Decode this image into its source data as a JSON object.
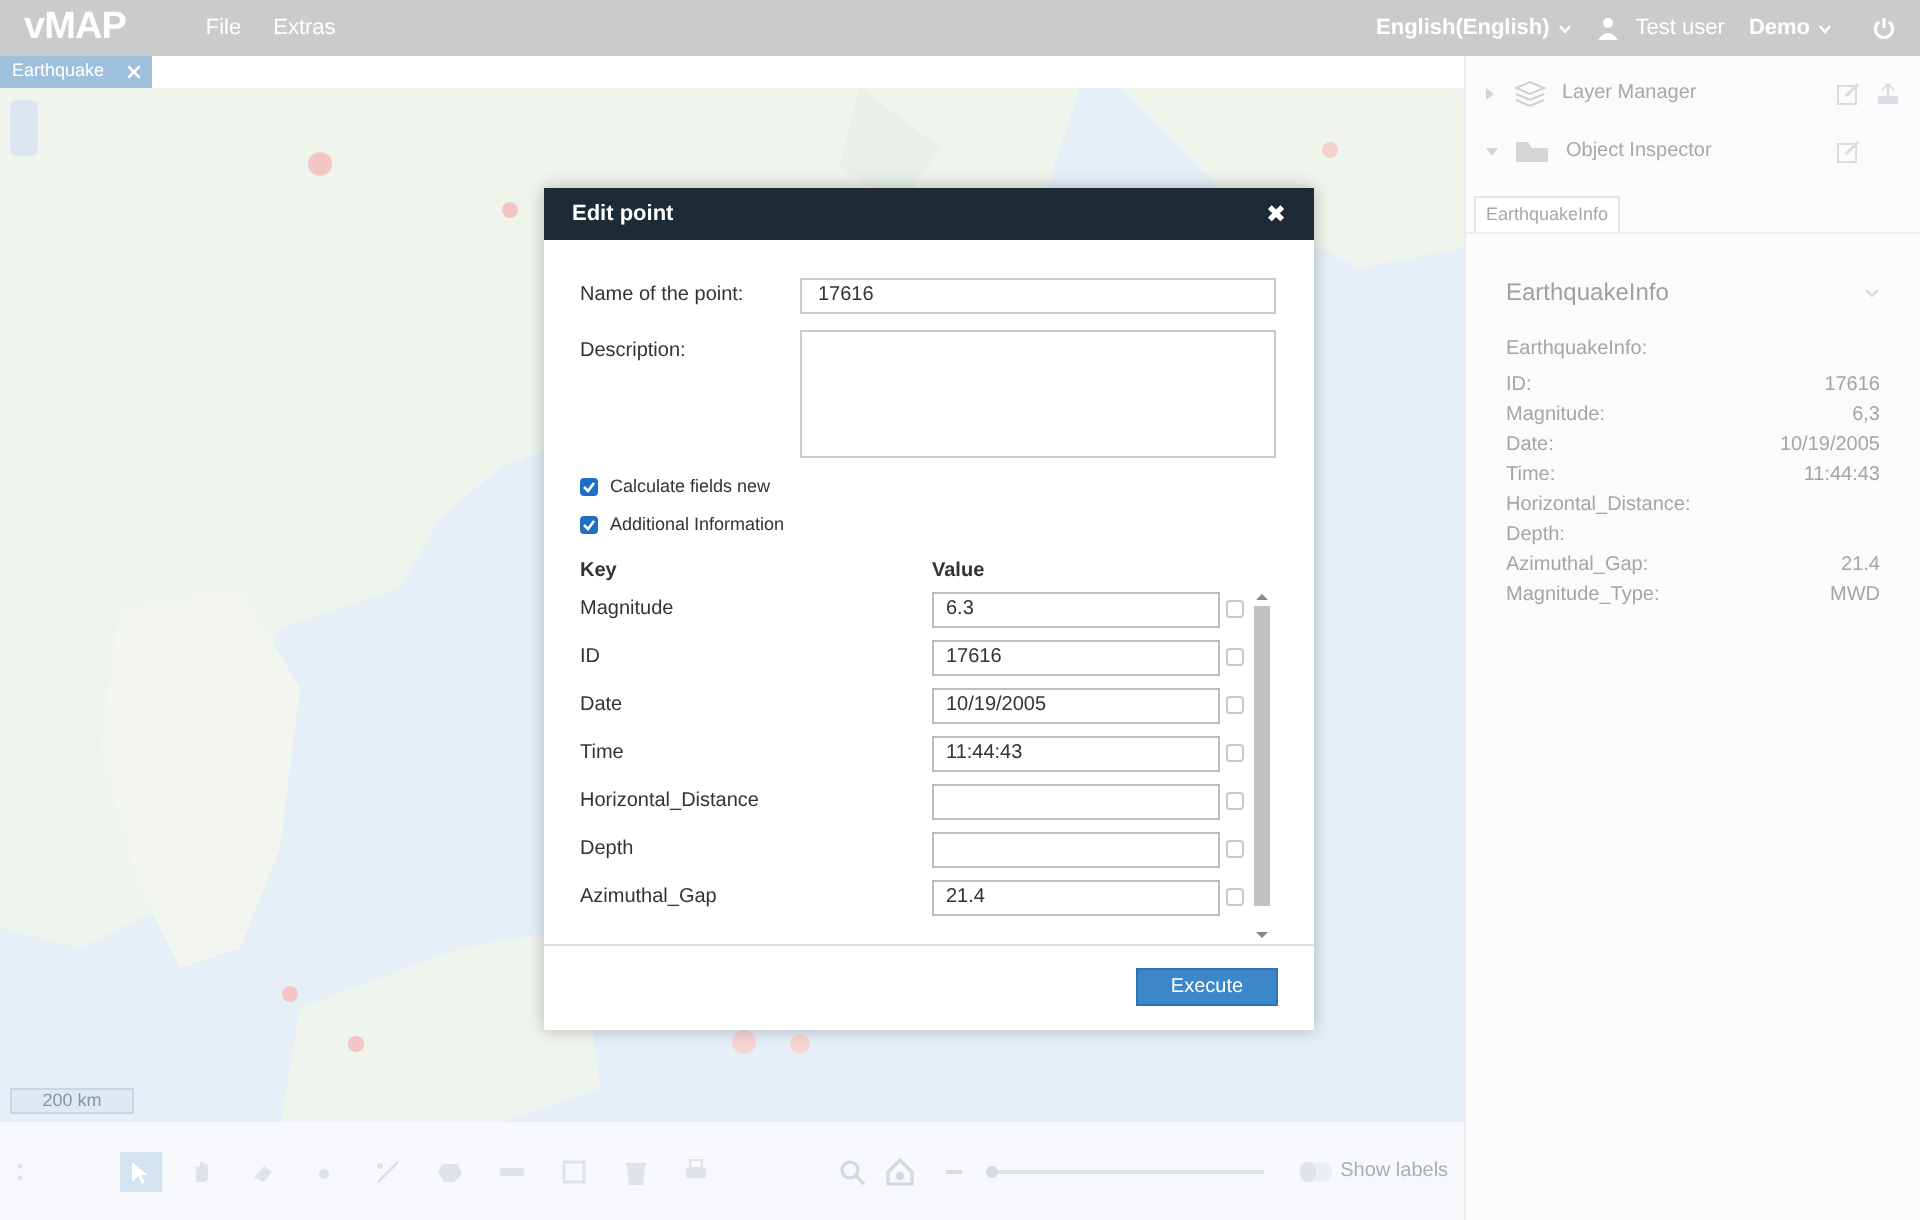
{
  "app": {
    "logo": "vMAP",
    "menu": [
      "File",
      "Extras"
    ],
    "language": "English(English)",
    "user": "Test user",
    "project": "Demo"
  },
  "map_tabs": [
    {
      "label": "Earthquake",
      "selected": true
    }
  ],
  "map": {
    "scale": "200 km"
  },
  "panels": [
    {
      "title": "Layer Manager",
      "expanded": false
    },
    {
      "title": "Object Inspector",
      "expanded": true
    }
  ],
  "inspector_tabs": [
    {
      "label": "EarthquakeInfo",
      "selected": true
    }
  ],
  "info_card": {
    "title": "EarthquakeInfo",
    "subtitle": "EarthquakeInfo:",
    "rows": [
      {
        "key": "ID:",
        "value": "17616"
      },
      {
        "key": "Magnitude:",
        "value": "6,3"
      },
      {
        "key": "Date:",
        "value": "10/19/2005"
      },
      {
        "key": "Time:",
        "value": "11:44:43"
      },
      {
        "key": "Horizontal_Distance:",
        "value": ""
      },
      {
        "key": "Depth:",
        "value": ""
      },
      {
        "key": "Azimuthal_Gap:",
        "value": "21.4"
      },
      {
        "key": "Magnitude_Type:",
        "value": "MWD"
      }
    ]
  },
  "tools": [
    {
      "kind": "select",
      "selected": true
    },
    {
      "kind": "pan",
      "selected": false
    },
    {
      "kind": "eraser",
      "selected": false
    },
    {
      "kind": "point",
      "selected": false
    },
    {
      "kind": "line",
      "selected": false
    },
    {
      "kind": "polygon",
      "selected": false
    },
    {
      "kind": "bar",
      "selected": false
    },
    {
      "kind": "square",
      "selected": false
    },
    {
      "kind": "trash",
      "selected": false
    },
    {
      "kind": "print",
      "selected": false
    }
  ],
  "zoom": {
    "level": 0.0
  },
  "show_labels": {
    "label": "Show labels",
    "on": false
  },
  "dialog": {
    "title": "Edit point",
    "close": "✖",
    "name_label": "Name of the point:",
    "name_value": "17616",
    "description_label": "Description:",
    "checkboxes": [
      {
        "label": "Calculate fields new",
        "checked": true
      },
      {
        "label": "Additional Information",
        "checked": true
      }
    ],
    "columns": [
      "Key",
      "Value"
    ],
    "rows": [
      {
        "key": "Magnitude",
        "value": "6.3",
        "checked": false
      },
      {
        "key": "ID",
        "value": "17616",
        "checked": false
      },
      {
        "key": "Date",
        "value": "10/19/2005",
        "checked": false
      },
      {
        "key": "Time",
        "value": "11:44:43",
        "checked": false
      },
      {
        "key": "Horizontal_Distance",
        "value": "",
        "checked": false
      },
      {
        "key": "Depth",
        "value": "",
        "checked": false
      },
      {
        "key": "Azimuthal_Gap",
        "value": "21.4",
        "checked": false
      }
    ],
    "button": "Execute"
  }
}
